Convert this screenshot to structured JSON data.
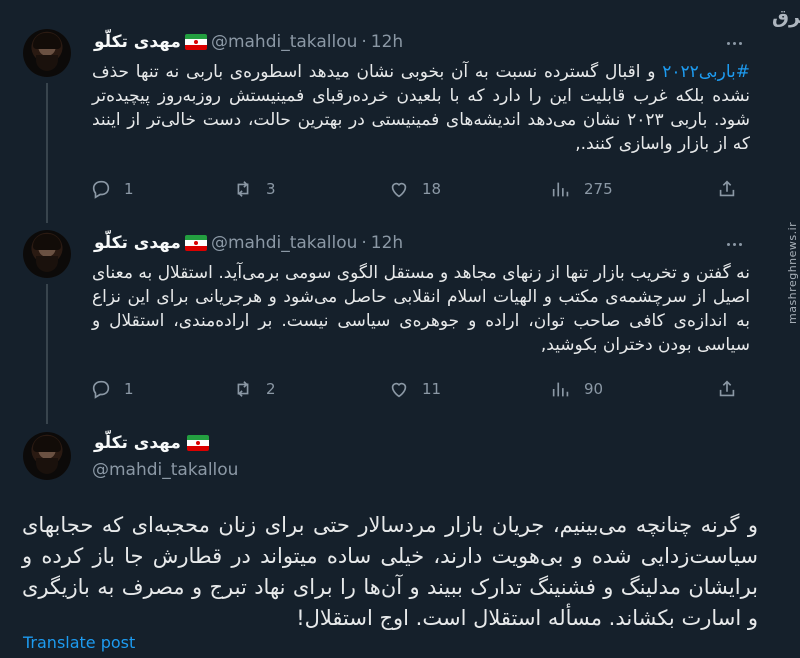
{
  "tweets": [
    {
      "name": "مهدی تکلّو",
      "handle": "@mahdi_takallou",
      "dot": "·",
      "time": "12h",
      "hashtag": "#باربی۲۰۲۲",
      "text": " و اقبال گسترده نسبت به آن بخوبی نشان میدهد اسطوره‌ی باربی نه تنها حذف نشده بلکه غرب قابلیت این را دارد که با بلعیدن خرده‌رقبای فمینیستش روزبه‌روز پیچیده‌تر شود. باربی ۲۰۲۳ نشان می‌دهد اندیشه‌های فمینیستی در بهترین حالت، دست خالی‌تر از اینند که از بازار واسازی کنند.,",
      "stats": {
        "replies": "1",
        "retweets": "3",
        "likes": "18",
        "views": "275"
      }
    },
    {
      "name": "مهدی تکلّو",
      "handle": "@mahdi_takallou",
      "dot": "·",
      "time": "12h",
      "text": "نه گفتن و تخریب بازار تنها از زنهای مجاهد و مستقل الگوی سومی برمی‌آید. استقلال به معنای  اصیل از سرچشمه‌ی مکتب و الهیات اسلام انقلابی حاصل می‌شود و هرجریانی برای این نزاع به اندازه‌ی کافی صاحب توان، اراده و جوهره‌ی سیاسی نیست. بر اراده‌مندی، استقلال و سیاسی بودن دختران بکوشید,",
      "stats": {
        "replies": "1",
        "retweets": "2",
        "likes": "11",
        "views": "90"
      }
    },
    {
      "name": "مهدی تکلّو",
      "handle": "@mahdi_takallou",
      "text": "و گرنه چنانچه می‌بینیم، جریان بازار مردسالار حتی برای زنان محجبه‌ای که حجابهای سیاست‌زدایی شده و بی‌هویت دارند، خیلی ساده میتواند در قطارش جا باز کرده و برایشان مدلینگ و فشنینگ تدارک ببیند و آن‌ها را برای نهاد تبرج و مصرف به بازیگری و اسارت بکشاند. مسأله استقلال است. اوج استقلال!",
      "translate": "Translate post"
    }
  ],
  "watermark": {
    "logo": "مشرق",
    "site": "mashreghnews.ir"
  },
  "icons": [
    "reply-icon",
    "retweet-icon",
    "like-icon",
    "views-icon",
    "share-icon",
    "more-icon",
    "flag-icon"
  ],
  "colors": {
    "background": "#15202b",
    "accent": "#1d9bf0",
    "muted": "#8b98a5",
    "text": "#e7e9ea",
    "divider": "#38444d"
  }
}
